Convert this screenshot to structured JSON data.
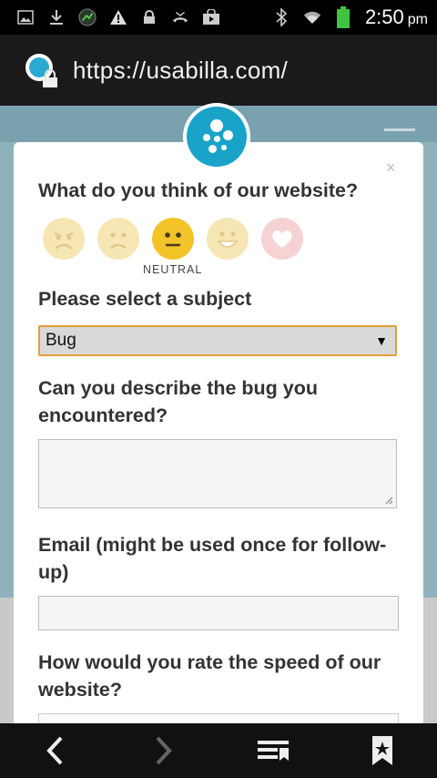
{
  "status_bar": {
    "time": "2:50",
    "ampm": "pm",
    "left_icons": [
      "gallery-icon",
      "download-icon",
      "speed-icon",
      "warning-icon",
      "lock-icon",
      "missed-call-icon",
      "store-icon"
    ],
    "right_icons": [
      "bluetooth-icon",
      "wifi-icon",
      "battery-icon"
    ],
    "battery_color": "#3ec43e"
  },
  "browser": {
    "url": "https://usabilla.com/"
  },
  "survey": {
    "close_symbol": "×",
    "q1": "What do you think of our website?",
    "moods": [
      {
        "name": "angry",
        "color": "#f6e6b4"
      },
      {
        "name": "sad",
        "color": "#f6e6b4"
      },
      {
        "name": "neutral",
        "color": "#f3c42a"
      },
      {
        "name": "happy",
        "color": "#f6e6b4"
      },
      {
        "name": "love",
        "color": "#f6d2d2"
      }
    ],
    "selected_mood_label": "NEUTRAL",
    "q2": "Please select a subject",
    "subject_value": "Bug",
    "subject_caret": "▼",
    "q3": "Can you describe the bug you encountered?",
    "q4": "Email (might be used once for follow-up)",
    "q5": "How would you rate the speed of our website?",
    "accent_color": "#1aa3c9"
  },
  "nav": {
    "icons": [
      "back-icon",
      "forward-icon",
      "tabs-icon",
      "bookmark-icon"
    ]
  }
}
